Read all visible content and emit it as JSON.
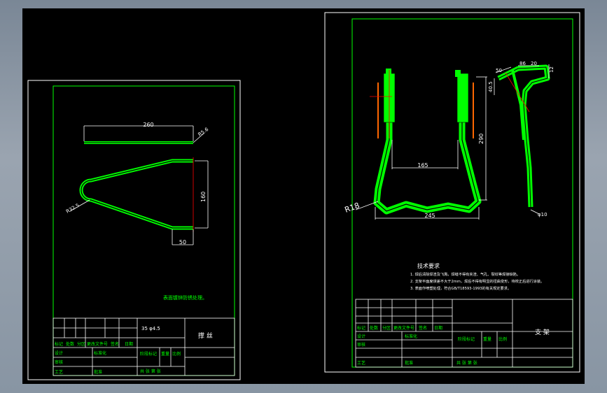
{
  "colors": {
    "line": "#00ff00",
    "sheet": "#ffffff",
    "dim": "#ffffff",
    "center": "#ff0000",
    "bg": "#000000"
  },
  "sheet1": {
    "dims": {
      "d260": "260",
      "d5_6": "R5.6",
      "d160": "160",
      "d50": "50",
      "r32_5": "R32.5"
    },
    "note": "表面镀锌防锈处理。",
    "material": "35  φ4.5",
    "part_name": "撑  丝",
    "tb": {
      "c1": "标记",
      "c2": "处数",
      "c3": "分区",
      "c4": "更改文件号",
      "c5": "签名",
      "c6": "日期",
      "design": "设计",
      "std": "标准化",
      "check": "审核",
      "process": "工艺",
      "approve": "批准",
      "stage": "阶段标记",
      "weight": "重量",
      "scale": "比例",
      "sheets": "共    张  第    张"
    }
  },
  "sheet2": {
    "dims": {
      "d290": "290",
      "d165": "165",
      "d245": "245",
      "r18": "R18",
      "d50": "50",
      "d86": "86",
      "d20": "20",
      "d12": "12",
      "d40_5": "40.5",
      "phi10": "φ10"
    },
    "tech_title": "技术要求",
    "tech": [
      "1. 焊后清除焊渣及飞溅，焊缝不得有夹渣、气孔、裂纹等焊接缺陷。",
      "2. 支架平面度误差不大于2mm，焊后不得有明显的扭曲变形，待校正后进行涂装。",
      "3. 表面作喷塑处理，符合GB/T18593-1993的有关规定要求。"
    ],
    "part_name": "支  架",
    "tb": {
      "c1": "标记",
      "c2": "处数",
      "c3": "分区",
      "c4": "更改文件号",
      "c5": "签名",
      "c6": "日期",
      "design": "设计",
      "std": "标准化",
      "check": "审核",
      "process": "工艺",
      "approve": "批准",
      "stage": "阶段标记",
      "weight": "重量",
      "scale": "比例",
      "sheets": "共    张  第    张"
    }
  }
}
